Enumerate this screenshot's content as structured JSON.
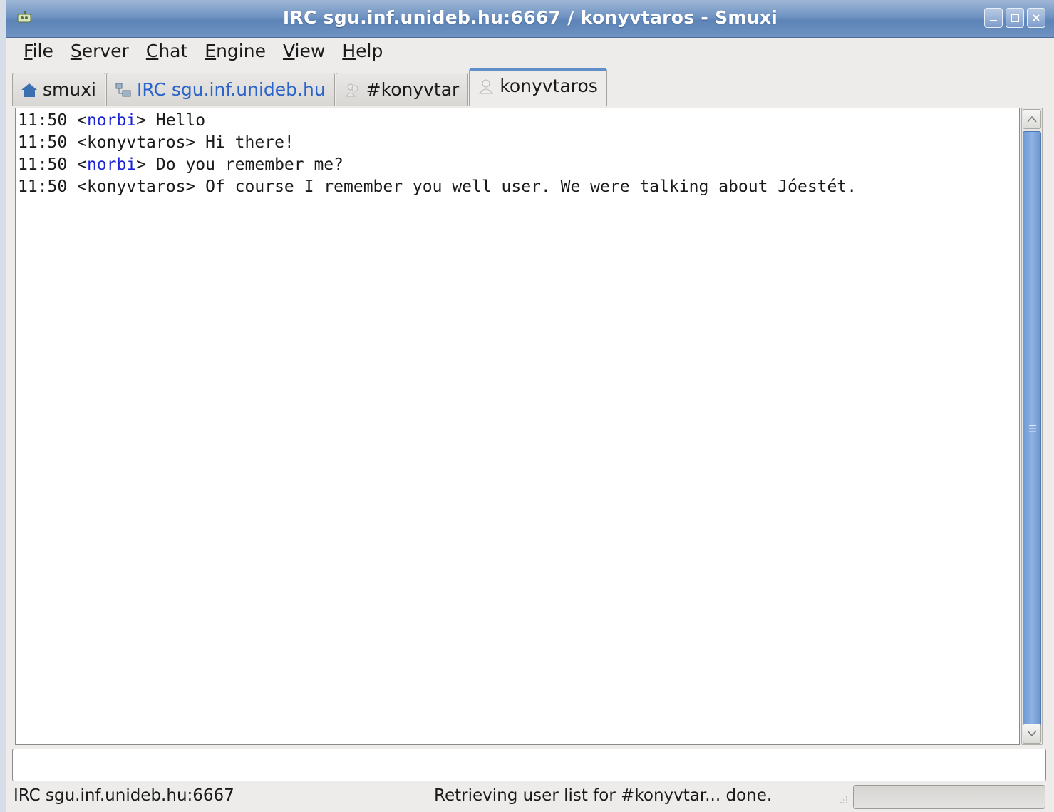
{
  "window": {
    "title": "IRC sgu.inf.unideb.hu:6667 / konyvtaros - Smuxi"
  },
  "menubar": {
    "items": [
      {
        "label": "File",
        "mnemonic": "F",
        "rest": "ile"
      },
      {
        "label": "Server",
        "mnemonic": "S",
        "rest": "erver"
      },
      {
        "label": "Chat",
        "mnemonic": "C",
        "rest": "hat"
      },
      {
        "label": "Engine",
        "mnemonic": "E",
        "rest": "ngine"
      },
      {
        "label": "View",
        "mnemonic": "V",
        "rest": "iew"
      },
      {
        "label": "Help",
        "mnemonic": "H",
        "rest": "elp"
      }
    ]
  },
  "tabs": [
    {
      "label": "smuxi",
      "icon": "home-icon",
      "active": false
    },
    {
      "label": "IRC sgu.inf.unideb.hu",
      "icon": "network-icon",
      "active": false
    },
    {
      "label": "#konyvtar",
      "icon": "group-icon",
      "active": false
    },
    {
      "label": "konyvtaros",
      "icon": "person-icon",
      "active": true
    }
  ],
  "messages": [
    {
      "time": "11:50",
      "nick": "norbi",
      "text": "Hello",
      "own": true
    },
    {
      "time": "11:50",
      "nick": "konyvtaros",
      "text": "Hi there!",
      "own": false
    },
    {
      "time": "11:50",
      "nick": "norbi",
      "text": "Do you remember me?",
      "own": true
    },
    {
      "time": "11:50",
      "nick": "konyvtaros",
      "text": "Of course I remember you well user. We were talking about Jóestét.",
      "own": false
    }
  ],
  "input": {
    "value": ""
  },
  "statusbar": {
    "network": "IRC sgu.inf.unideb.hu:6667",
    "message": "Retrieving user list for #konyvtar... done."
  },
  "colors": {
    "own_nick": "#1a24d6",
    "titlebar": "#6f93c2",
    "active_tab_accent": "#5f8ec9"
  }
}
